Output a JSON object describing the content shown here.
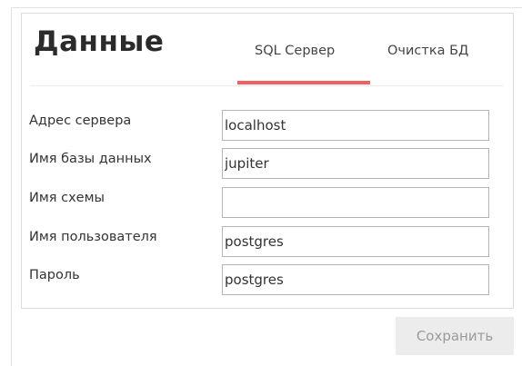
{
  "panel": {
    "title": "Данные"
  },
  "tabs": [
    {
      "label": "SQL Сервер",
      "active": true
    },
    {
      "label": "Очистка БД",
      "active": false
    }
  ],
  "form": {
    "fields": [
      {
        "label": "Адрес сервера",
        "value": "localhost"
      },
      {
        "label": "Имя базы данных",
        "value": "jupiter"
      },
      {
        "label": "Имя схемы",
        "value": ""
      },
      {
        "label": "Имя пользователя",
        "value": "postgres"
      },
      {
        "label": "Пароль",
        "value": "postgres"
      }
    ]
  },
  "actions": {
    "save_label": "Сохранить"
  },
  "colors": {
    "active_tab_underline": "#ef5f63",
    "disabled_button_bg": "#ececec",
    "disabled_button_text": "#9a9a9a"
  }
}
